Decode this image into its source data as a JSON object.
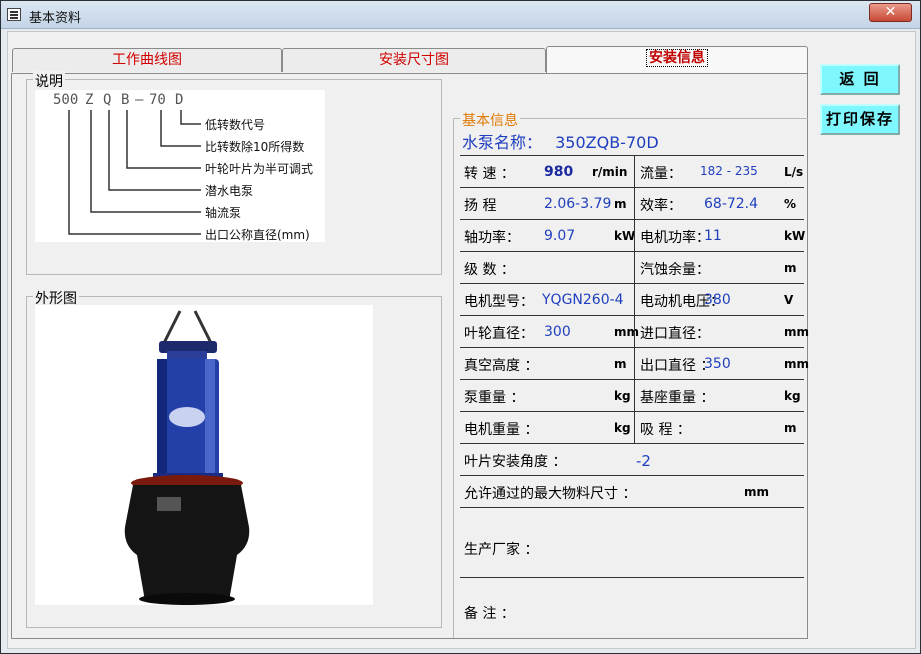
{
  "window": {
    "title": "基本资料",
    "close_label": "✕"
  },
  "tabs": [
    {
      "label": "工作曲线图",
      "active": false
    },
    {
      "label": "安装尺寸图",
      "active": false
    },
    {
      "label": "安装信息",
      "active": true
    }
  ],
  "buttons": {
    "back": "返 回",
    "print_save": "打印保存"
  },
  "legend": {
    "title": "说明",
    "code_parts": [
      "500",
      "Z",
      "Q",
      "B",
      "—",
      "70",
      "D"
    ],
    "items": [
      "低转数代号",
      "比转数除10所得数",
      "叶轮叶片为半可调式",
      "潜水电泵",
      "轴流泵",
      "出口公称直径(mm)"
    ]
  },
  "outline": {
    "title": "外形图",
    "image_alt": "submersible axial-flow pump"
  },
  "info": {
    "title": "基本信息",
    "pump_name_label": "水泵名称：",
    "pump_name_value": "350ZQB-70D",
    "rows": [
      {
        "l_label": "转 速 ：",
        "l_val": "980",
        "l_unit": "r/min",
        "r_label": "流量：",
        "r_val": "182 - 235",
        "r_unit": "L/s"
      },
      {
        "l_label": "扬 程",
        "l_val": "2.06-3.79",
        "l_unit": "m",
        "r_label": "效率：",
        "r_val": "68-72.4",
        "r_unit": "%"
      },
      {
        "l_label": "轴功率：",
        "l_val": "9.07",
        "l_unit": "kW",
        "r_label": "电机功率：",
        "r_val": "11",
        "r_unit": "kW"
      },
      {
        "l_label": "级 数 ：",
        "l_val": "",
        "l_unit": "",
        "r_label": "汽蚀余量：",
        "r_val": "",
        "r_unit": "m"
      },
      {
        "l_label": "电机型号：",
        "l_val": "YQGN260-4",
        "l_unit": "",
        "r_label": "电动机电压：",
        "r_val": "380",
        "r_unit": "V"
      },
      {
        "l_label": "叶轮直径：",
        "l_val": "300",
        "l_unit": "mm",
        "r_label": "进口直径：",
        "r_val": "",
        "r_unit": "mm"
      },
      {
        "l_label": "真空高度 ：",
        "l_val": "",
        "l_unit": "m",
        "r_label": "出口直径 ：",
        "r_val": "350",
        "r_unit": "mm"
      },
      {
        "l_label": "泵重量 ：",
        "l_val": "",
        "l_unit": "kg",
        "r_label": "基座重量 ：",
        "r_val": "",
        "r_unit": "kg"
      },
      {
        "l_label": "电机重量 ：",
        "l_val": "",
        "l_unit": "kg",
        "r_label": "吸 程 ：",
        "r_val": "",
        "r_unit": "m"
      }
    ],
    "blade_angle_label": "叶片安装角度 ：",
    "blade_angle_value": "-2",
    "max_material_label": "允许通过的最大物料尺寸 ：",
    "max_material_unit": "mm",
    "manufacturer_label": "生产厂家 ：",
    "remarks_label": "备  注 ："
  }
}
